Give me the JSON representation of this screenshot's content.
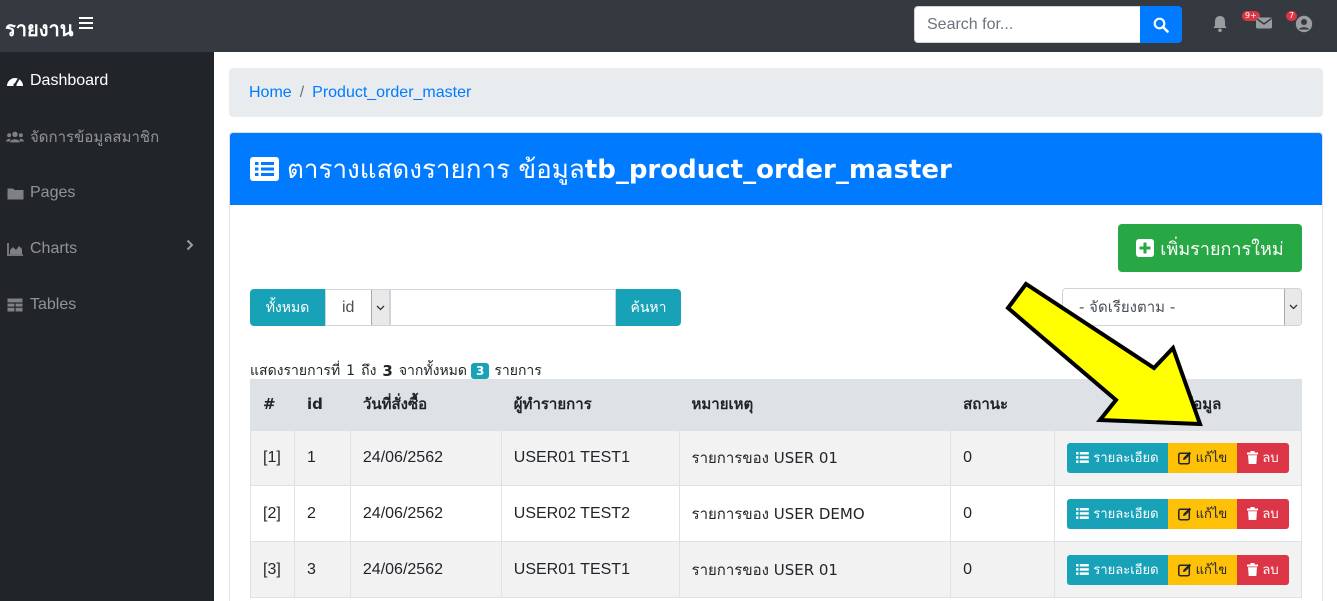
{
  "navbar": {
    "brand": "รายงาน",
    "search_placeholder": "Search for...",
    "alerts_badge": "9+",
    "messages_badge": "7"
  },
  "sidebar": {
    "items": [
      {
        "label": "Dashboard",
        "icon": "tachometer-icon"
      },
      {
        "label": "จัดการข้อมูลสมาชิก",
        "icon": "users-icon"
      },
      {
        "label": "Pages",
        "icon": "folder-icon"
      },
      {
        "label": "Charts",
        "icon": "area-chart-icon"
      },
      {
        "label": "Tables",
        "icon": "table-icon"
      }
    ]
  },
  "breadcrumb": {
    "home": "Home",
    "separator": "/",
    "current": "Product_order_master"
  },
  "card": {
    "title_prefix": "ตารางแสดงรายการ ข้อมูล",
    "title_bold": "tb_product_order_master",
    "add_button": "เพิ่มรายการใหม่"
  },
  "filter": {
    "all_button": "ทั้งหมด",
    "field_selected": "id",
    "search_value": "",
    "search_button": "ค้นหา",
    "sort_selected": "- จัดเรียงตาม -"
  },
  "summary": {
    "prefix": "แสดงรายการที่",
    "from": "1",
    "to_label": "ถึง",
    "to": "3",
    "total_label": "จากทั้งหมด",
    "total": "3",
    "suffix": "รายการ"
  },
  "table": {
    "columns": [
      "#",
      "id",
      "วันที่สั่งซื้อ",
      "ผู้ทำรายการ",
      "หมายเหตุ",
      "สถานะ",
      "ข้อมูล"
    ],
    "rows": [
      {
        "index": "[1]",
        "id": "1",
        "date": "24/06/2562",
        "user": "USER01 TEST1",
        "note": "รายการของ USER 01",
        "status": "0"
      },
      {
        "index": "[2]",
        "id": "2",
        "date": "24/06/2562",
        "user": "USER02 TEST2",
        "note": "รายการของ USER DEMO",
        "status": "0"
      },
      {
        "index": "[3]",
        "id": "3",
        "date": "24/06/2562",
        "user": "USER01 TEST1",
        "note": "รายการของ USER 01",
        "status": "0"
      }
    ],
    "actions": {
      "detail": "รายละเอียด",
      "edit": "แก้ไข",
      "delete": "ลบ"
    }
  },
  "colors": {
    "primary": "#007bff",
    "success": "#28a745",
    "info": "#17a2b8",
    "warning": "#ffc107",
    "danger": "#dc3545",
    "annotation_arrow": "#ffff00"
  }
}
